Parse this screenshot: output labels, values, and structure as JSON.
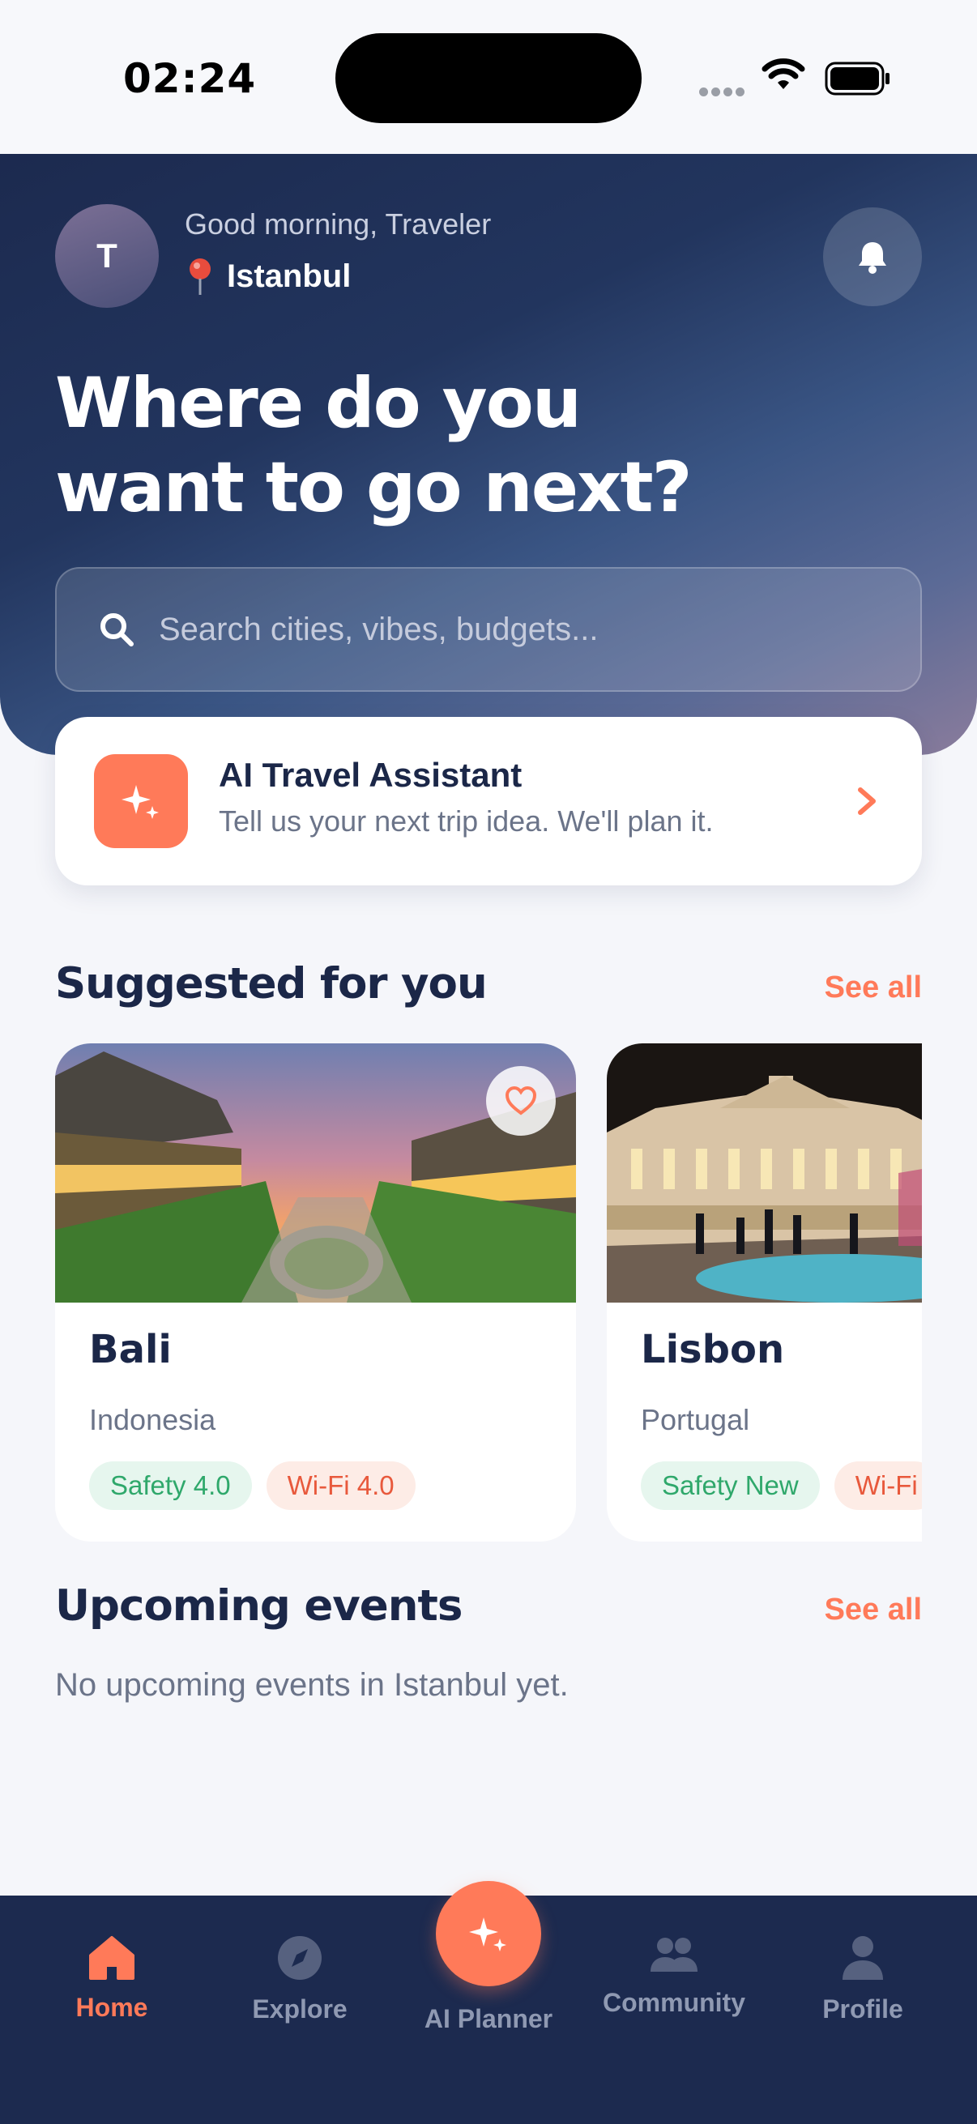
{
  "status_bar": {
    "time": "02:24"
  },
  "header": {
    "avatar_initial": "T",
    "greeting": "Good morning, Traveler",
    "location": "Istanbul",
    "headline_line1": "Where do you",
    "headline_line2": "want to go next?"
  },
  "search": {
    "placeholder": "Search cities, vibes, budgets..."
  },
  "ai_assistant": {
    "title": "AI Travel Assistant",
    "subtitle": "Tell us your next trip idea. We'll plan it."
  },
  "suggested": {
    "title": "Suggested for you",
    "see_all": "See all",
    "cards": [
      {
        "name": "Bali",
        "country": "Indonesia",
        "chips": [
          "Safety 4.0",
          "Wi-Fi 4.0"
        ]
      },
      {
        "name": "Lisbon",
        "country": "Portugal",
        "chips": [
          "Safety New",
          "Wi-Fi"
        ]
      }
    ]
  },
  "events": {
    "title": "Upcoming events",
    "see_all": "See all",
    "empty": "No upcoming events in Istanbul yet."
  },
  "nav": {
    "items": [
      {
        "label": "Home",
        "icon": "home-icon",
        "active": true
      },
      {
        "label": "Explore",
        "icon": "compass-icon"
      },
      {
        "label": "AI Planner",
        "icon": "sparkle-icon"
      },
      {
        "label": "Community",
        "icon": "people-icon"
      },
      {
        "label": "Profile",
        "icon": "person-icon"
      }
    ]
  },
  "colors": {
    "accent": "#ff7a59",
    "navy": "#1c2a4f",
    "safety_green": "#2fa86b",
    "wifi_red": "#e8593c"
  }
}
